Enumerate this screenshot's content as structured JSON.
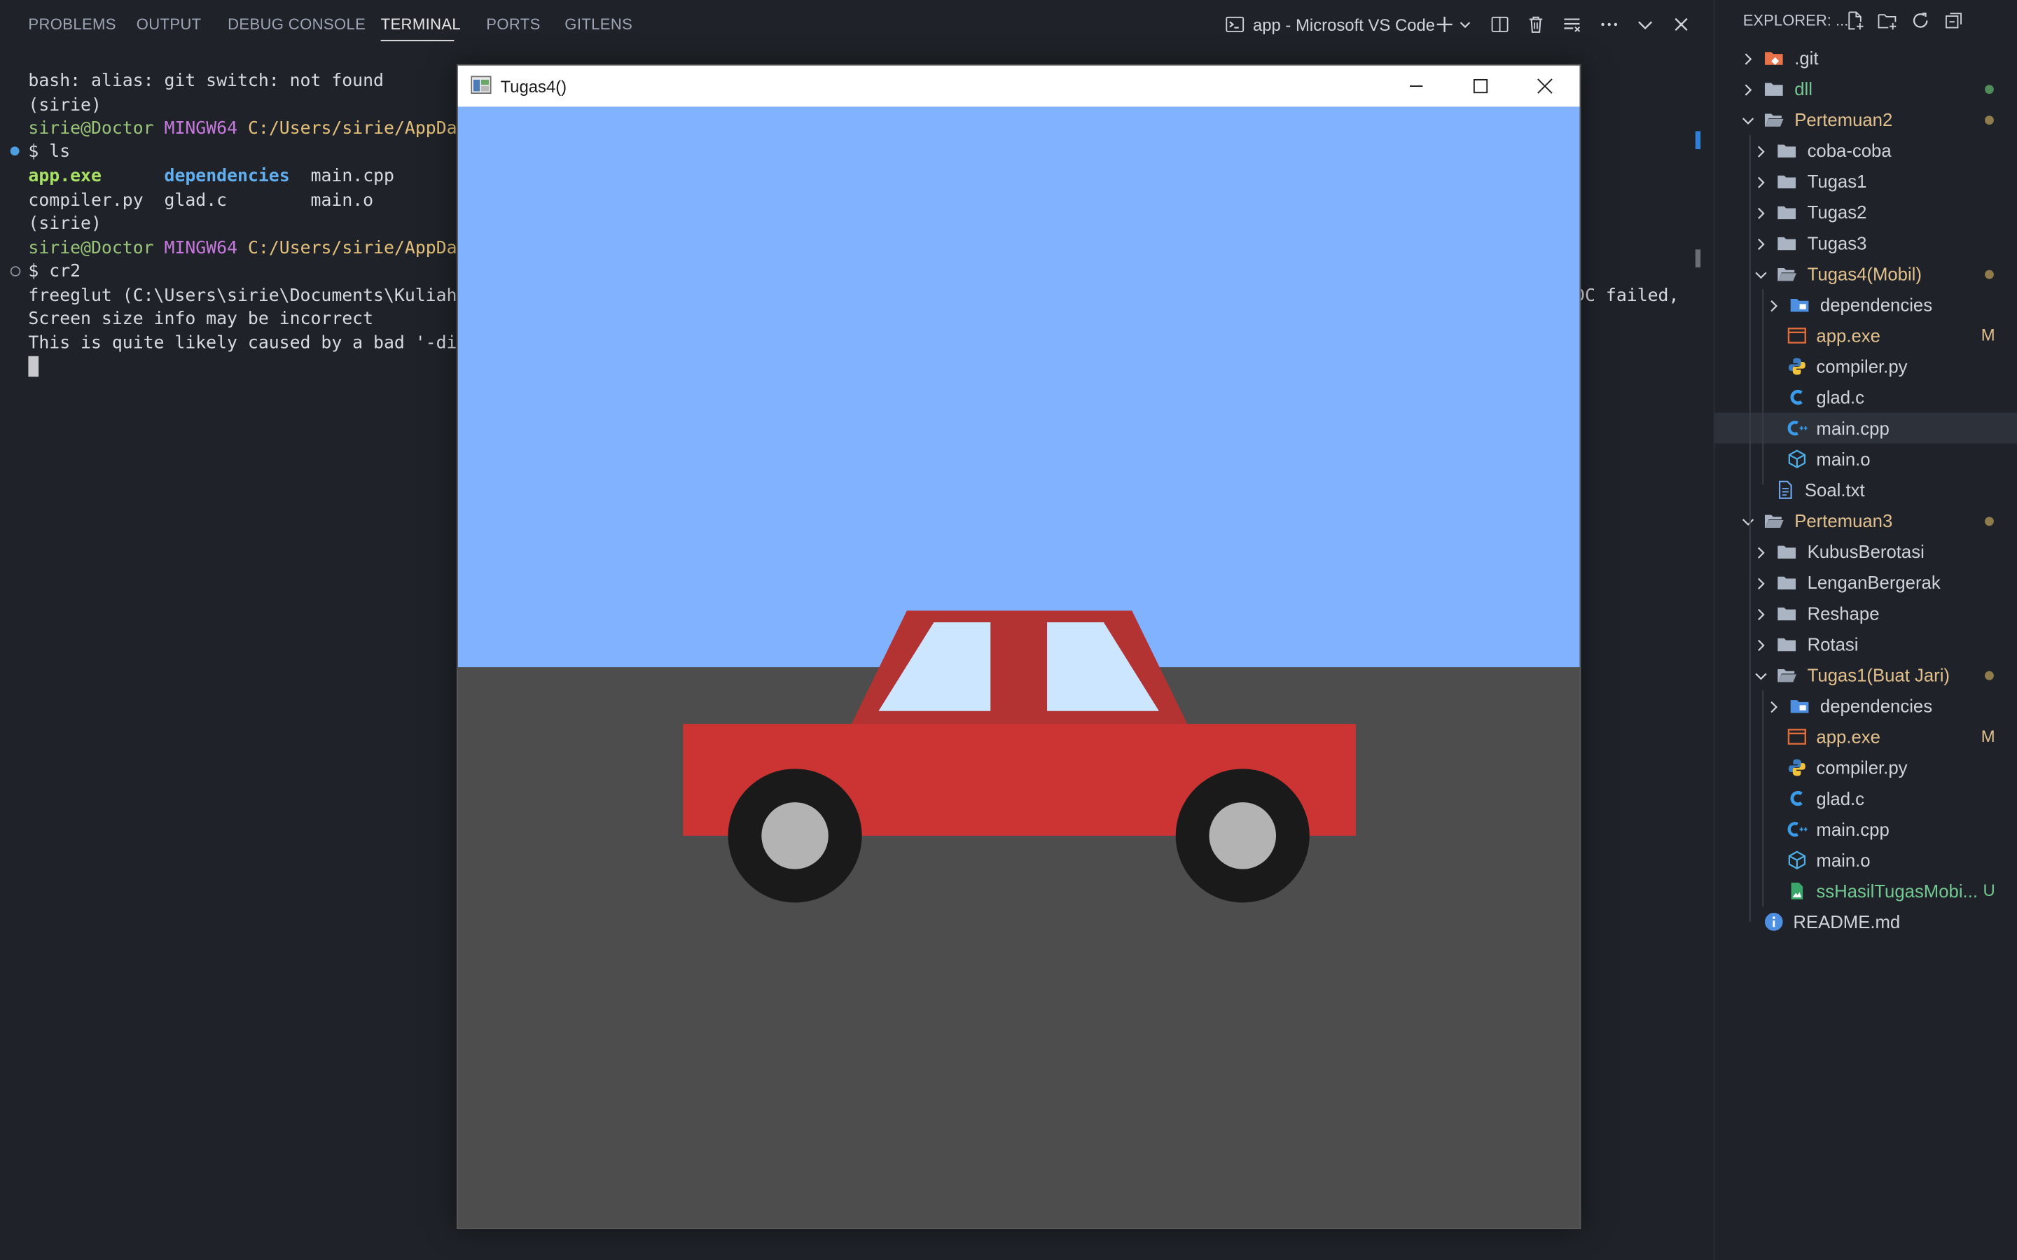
{
  "panel": {
    "tabs": [
      "PROBLEMS",
      "OUTPUT",
      "DEBUG CONSOLE",
      "TERMINAL",
      "PORTS",
      "GITLENS"
    ],
    "active_tab": "TERMINAL",
    "terminal_title": "app - Microsoft VS Code"
  },
  "terminal": {
    "line1": "bash: alias: git switch: not found",
    "line2": "(sirie)",
    "prompt_user": "sirie@Doctor",
    "prompt_env": "MINGW64",
    "prompt_path": "C:/Users/sirie/AppDa",
    "cmd1": "$ ls",
    "ls_row1": [
      "app.exe",
      "dependencies",
      "main.cpp"
    ],
    "ls_row2": [
      "compiler.py",
      "glad.c",
      "main.o"
    ],
    "line_sirie2": "(sirie)",
    "prompt_user2": "sirie@Doctor",
    "prompt_env2": "MINGW64",
    "prompt_path2": "C:/Users/sirie/AppDa",
    "cmd2": "$ cr2",
    "freeglut": "freeglut (C:\\Users\\sirie\\Documents\\Kuliah",
    "freeglut_tail": "DC failed,",
    "screen_info": "Screen size info may be incorrect",
    "likely": "This is quite likely caused by a bad '-di"
  },
  "explorer": {
    "header": "EXPLORER: ...",
    "items": [
      {
        "label": ".git",
        "kind": "folder-git",
        "depth": 0,
        "expanded": false
      },
      {
        "label": "dll",
        "kind": "folder",
        "depth": 0,
        "expanded": false,
        "status": "untracked-dot"
      },
      {
        "label": "Pertemuan2",
        "kind": "folder-open",
        "depth": 0,
        "expanded": true,
        "status": "mod-dot"
      },
      {
        "label": "coba-coba",
        "kind": "folder",
        "depth": 1,
        "expanded": false
      },
      {
        "label": "Tugas1",
        "kind": "folder",
        "depth": 1,
        "expanded": false
      },
      {
        "label": "Tugas2",
        "kind": "folder",
        "depth": 1,
        "expanded": false
      },
      {
        "label": "Tugas3",
        "kind": "folder",
        "depth": 1,
        "expanded": false
      },
      {
        "label": "Tugas4(Mobil)",
        "kind": "folder-open",
        "depth": 1,
        "expanded": true,
        "status": "mod-dot"
      },
      {
        "label": "dependencies",
        "kind": "folder-dep",
        "depth": 2,
        "expanded": false
      },
      {
        "label": "app.exe",
        "kind": "exe",
        "depth": 2,
        "badge": "M"
      },
      {
        "label": "compiler.py",
        "kind": "py",
        "depth": 2
      },
      {
        "label": "glad.c",
        "kind": "c",
        "depth": 2
      },
      {
        "label": "main.cpp",
        "kind": "cpp",
        "depth": 2,
        "selected": true
      },
      {
        "label": "main.o",
        "kind": "obj",
        "depth": 2
      },
      {
        "label": "Soal.txt",
        "kind": "txt",
        "depth": 1
      },
      {
        "label": "Pertemuan3",
        "kind": "folder-open",
        "depth": 0,
        "expanded": true,
        "status": "mod-dot"
      },
      {
        "label": "KubusBerotasi",
        "kind": "folder",
        "depth": 1,
        "expanded": false
      },
      {
        "label": "LenganBergerak",
        "kind": "folder",
        "depth": 1,
        "expanded": false
      },
      {
        "label": "Reshape",
        "kind": "folder",
        "depth": 1,
        "expanded": false
      },
      {
        "label": "Rotasi",
        "kind": "folder",
        "depth": 1,
        "expanded": false
      },
      {
        "label": "Tugas1(Buat Jari)",
        "kind": "folder-open",
        "depth": 1,
        "expanded": true,
        "status": "mod-dot"
      },
      {
        "label": "dependencies",
        "kind": "folder-dep",
        "depth": 2,
        "expanded": false
      },
      {
        "label": "app.exe",
        "kind": "exe",
        "depth": 2,
        "badge": "M"
      },
      {
        "label": "compiler.py",
        "kind": "py",
        "depth": 2
      },
      {
        "label": "glad.c",
        "kind": "c",
        "depth": 2
      },
      {
        "label": "main.cpp",
        "kind": "cpp",
        "depth": 2
      },
      {
        "label": "main.o",
        "kind": "obj",
        "depth": 2
      },
      {
        "label": "ssHasilTugasMobi...",
        "kind": "img",
        "depth": 2,
        "badge": "U"
      },
      {
        "label": "README.md",
        "kind": "info",
        "depth": 0
      }
    ]
  },
  "window": {
    "title": "Tugas4()",
    "colors": {
      "sky": "#80b2ff",
      "road": "#4d4d4d",
      "car_body": "#cc3333",
      "car_roof": "#b33333",
      "window_glass": "#cce6ff",
      "tire": "#1a1a1a",
      "hub": "#b3b3b3"
    }
  }
}
